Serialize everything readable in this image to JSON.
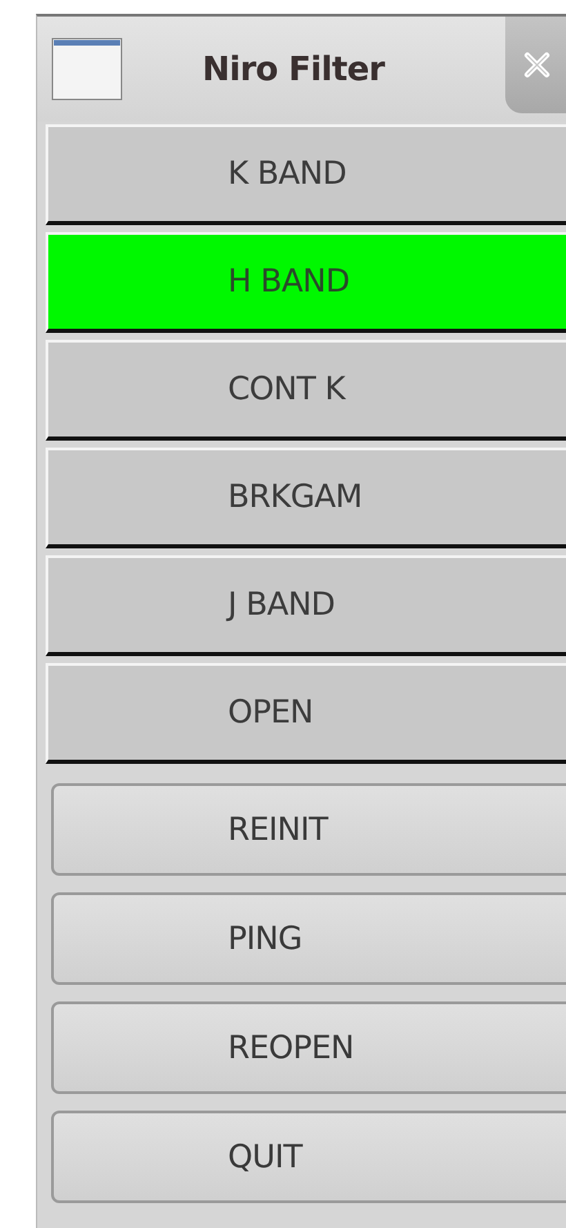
{
  "window": {
    "title": "Niro Filter"
  },
  "filters": [
    {
      "label": "K BAND",
      "selected": false
    },
    {
      "label": "H BAND",
      "selected": true
    },
    {
      "label": "CONT K",
      "selected": false
    },
    {
      "label": "BRKGAM",
      "selected": false
    },
    {
      "label": "J BAND",
      "selected": false
    },
    {
      "label": "OPEN",
      "selected": false
    }
  ],
  "commands": [
    "REINIT",
    "PING",
    "REOPEN",
    "QUIT"
  ]
}
